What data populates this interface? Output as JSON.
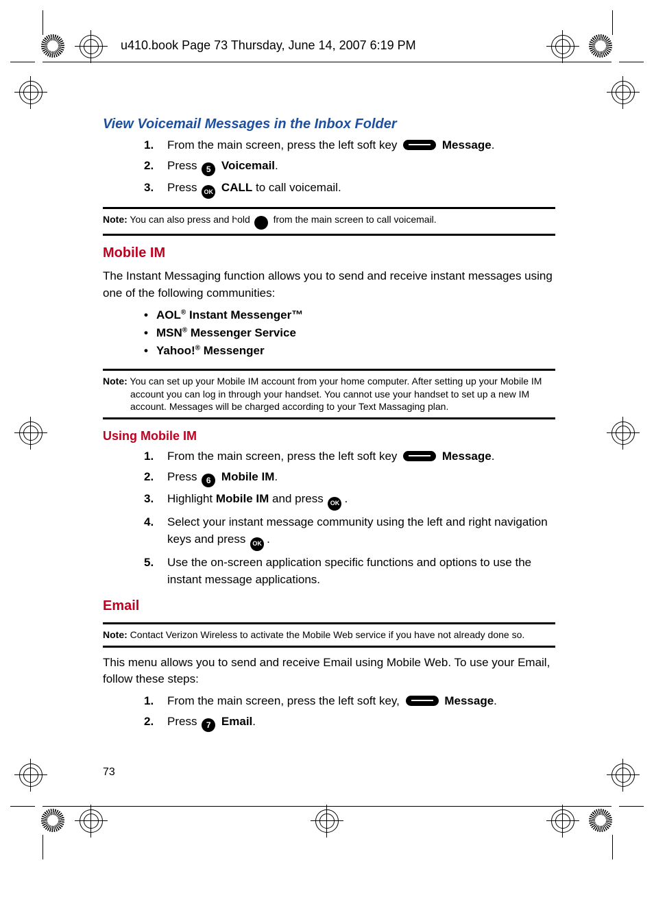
{
  "header": {
    "book_info": "u410.book  Page 73  Thursday, June 14, 2007  6:19 PM"
  },
  "page_number": "73",
  "section1": {
    "title": "View Voicemail Messages in the Inbox Folder",
    "steps": [
      {
        "n": "1.",
        "pre": "From the main screen, press the left soft key ",
        "icon": "pill",
        "bold": "Message",
        "post": "."
      },
      {
        "n": "2.",
        "pre": "Press ",
        "icon": "5",
        "bold": "Voicemail",
        "post": "."
      },
      {
        "n": "3.",
        "pre": "Press ",
        "icon": "OK",
        "bold": "CALL",
        "post": " to call voicemail."
      }
    ],
    "note": {
      "label": "Note:",
      "pre": " You can also press and hold ",
      "icon": "1",
      "post": " from the main screen to call voicemail."
    }
  },
  "section2": {
    "title": "Mobile IM",
    "intro": "The Instant Messaging function allows you to send and receive instant messages using one of the following communities:",
    "bullets": [
      {
        "a": "AOL",
        "sup": "®",
        "b": " Instant Messenger™"
      },
      {
        "a": "MSN",
        "sup": "®",
        "b": " Messenger Service"
      },
      {
        "a": "Yahoo!",
        "sup": "®",
        "b": " Messenger"
      }
    ],
    "note": {
      "label": "Note:",
      "text": " You can set up your Mobile IM account from your home computer. After setting up your Mobile IM account you can log in through your handset. You cannot use your handset to set up a new IM account. Messages will be charged according to your Text Massaging plan."
    }
  },
  "section3": {
    "title": "Using Mobile IM",
    "steps": [
      {
        "n": "1.",
        "pre": "From the main screen, press the left soft key ",
        "icon": "pill",
        "bold": "Message",
        "post": "."
      },
      {
        "n": "2.",
        "pre": "Press ",
        "icon": "6",
        "bold": "Mobile IM",
        "post": "."
      },
      {
        "n": "3.",
        "pre": "Highlight ",
        "bold": "Mobile IM",
        "mid": " and press ",
        "icon": "OK",
        "post": "."
      },
      {
        "n": "4.",
        "pre": "Select your instant message community using the left and right navigation keys and press ",
        "icon": "OK",
        "post": "."
      },
      {
        "n": "5.",
        "pre": "Use the on-screen application specific functions and options to use the instant message applications."
      }
    ]
  },
  "section4": {
    "title": "Email",
    "note": {
      "label": "Note:",
      "text": " Contact Verizon Wireless to activate the Mobile Web service if you have not already done so."
    },
    "intro": "This menu allows you to send and receive Email using Mobile Web. To use your Email, follow these steps:",
    "steps": [
      {
        "n": "1.",
        "pre": "From the main screen, press the left soft key, ",
        "icon": "pill",
        "bold": "Message",
        "post": "."
      },
      {
        "n": "2.",
        "pre": "Press ",
        "icon": "7",
        "bold": "Email",
        "post": "."
      }
    ]
  }
}
